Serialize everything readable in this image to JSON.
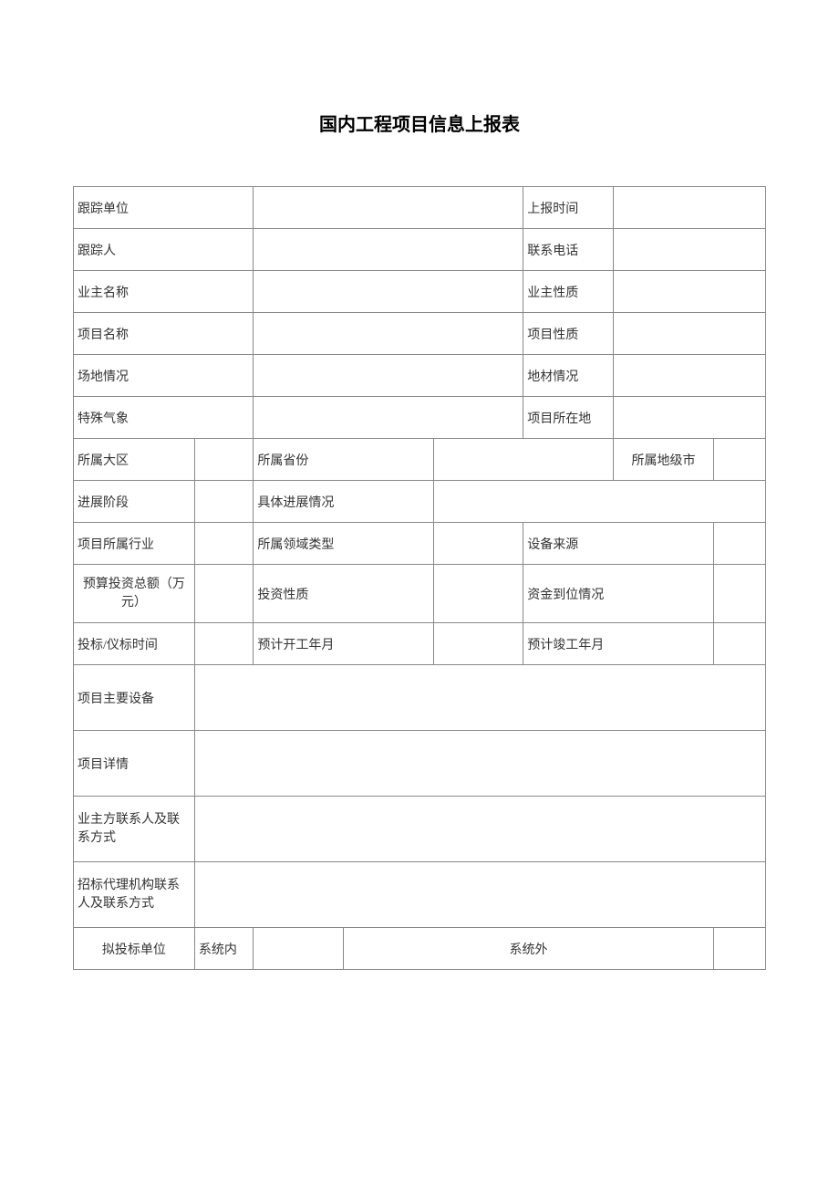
{
  "title": "国内工程项目信息上报表",
  "labels": {
    "tracking_unit": "跟踪单位",
    "report_time": "上报时间",
    "tracker": "跟踪人",
    "contact_phone": "联系电话",
    "owner_name": "业主名称",
    "owner_nature": "业主性质",
    "project_name": "项目名称",
    "project_nature": "项目性质",
    "site_condition": "场地情况",
    "material_condition": "地材情况",
    "special_weather": "特殊气象",
    "project_location": "项目所在地",
    "region": "所属大区",
    "province": "所属省份",
    "city": "所属地级市",
    "progress_stage": "进展阶段",
    "progress_detail": "具体进展情况",
    "industry": "项目所属行业",
    "domain_type": "所属领域类型",
    "equipment_source": "设备来源",
    "budget_total": "预算投资总额（万元）",
    "investment_nature": "投资性质",
    "fund_status": "资金到位情况",
    "bid_time": "投标/仪标时间",
    "start_date": "预计开工年月",
    "end_date": "预计竣工年月",
    "main_equipment": "项目主要设备",
    "project_detail": "项目详情",
    "owner_contact": "业主方联系人及联系方式",
    "bidding_agency_contact": "招标代理机构联系人及联系方式",
    "proposed_bidder": "拟投标单位",
    "system_internal": "系统内",
    "system_external": "系统外"
  },
  "values": {
    "tracking_unit": "",
    "report_time": "",
    "tracker": "",
    "contact_phone": "",
    "owner_name": "",
    "owner_nature": "",
    "project_name": "",
    "project_nature": "",
    "site_condition": "",
    "material_condition": "",
    "special_weather": "",
    "project_location": "",
    "region": "",
    "province": "",
    "city": "",
    "progress_stage": "",
    "progress_detail": "",
    "industry": "",
    "domain_type": "",
    "equipment_source": "",
    "budget_total": "",
    "investment_nature": "",
    "fund_status": "",
    "bid_time": "",
    "start_date": "",
    "end_date": "",
    "main_equipment": "",
    "project_detail": "",
    "owner_contact": "",
    "bidding_agency_contact": "",
    "system_internal_value": "",
    "system_external_value": ""
  }
}
